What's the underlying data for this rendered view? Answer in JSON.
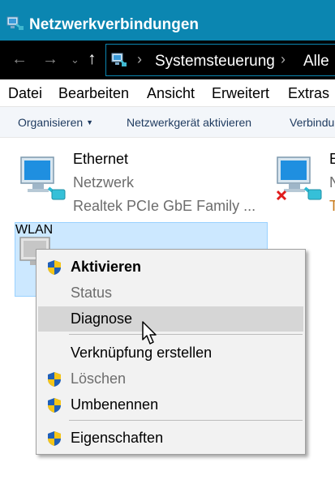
{
  "window": {
    "title": "Netzwerkverbindungen"
  },
  "address_bar": {
    "back_icon": "arrow-left-icon",
    "forward_icon": "arrow-right-icon",
    "up_icon": "arrow-up-icon",
    "breadcrumbs": [
      "Systemsteuerung",
      "Alle"
    ]
  },
  "menubar": {
    "items": [
      "Datei",
      "Bearbeiten",
      "Ansicht",
      "Erweitert",
      "Extras"
    ]
  },
  "commandbar": {
    "organize_label": "Organisieren",
    "activate_label": "Netzwerkgerät aktivieren",
    "connect_label": "Verbindu"
  },
  "connections": [
    {
      "name": "Ethernet",
      "status": "Netzwerk",
      "adapter": "Realtek PCIe GbE Family ..."
    },
    {
      "name": "E",
      "status": "N",
      "adapter": "T"
    },
    {
      "name": "WLAN"
    }
  ],
  "context_menu": {
    "items": [
      {
        "label": "Aktivieren",
        "bold": true,
        "shield": true,
        "disabled": false
      },
      {
        "label": "Status",
        "bold": false,
        "shield": false,
        "disabled": true
      },
      {
        "label": "Diagnose",
        "bold": false,
        "shield": false,
        "disabled": false,
        "hover": true
      },
      {
        "label": "Verknüpfung erstellen",
        "bold": false,
        "shield": false,
        "disabled": false
      },
      {
        "label": "Löschen",
        "bold": false,
        "shield": true,
        "disabled": true
      },
      {
        "label": "Umbenennen",
        "bold": false,
        "shield": true,
        "disabled": false
      },
      {
        "label": "Eigenschaften",
        "bold": false,
        "shield": true,
        "disabled": false
      }
    ]
  },
  "colors": {
    "titlebar": "#0b86b1",
    "selection": "#cce8ff",
    "menu_bg": "#f2f2f2",
    "hover": "#d6d6d6"
  }
}
